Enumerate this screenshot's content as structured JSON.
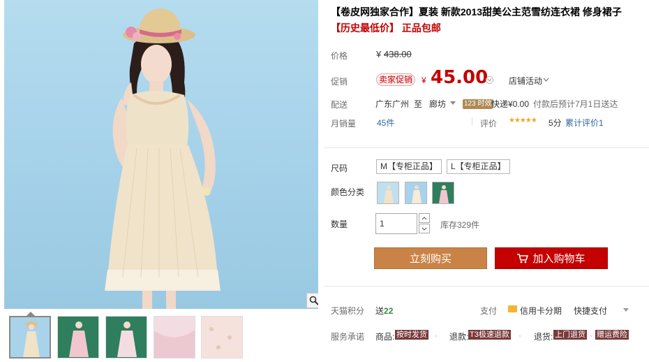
{
  "product": {
    "title": "【卷皮网独家合作】夏装 新款2013甜美公主范雪纺连衣裙 修身裙子",
    "subtitle": "【历史最低价】 正品包邮"
  },
  "price": {
    "label": "价格",
    "currency": "¥",
    "original": "438.00",
    "promo_label": "促销",
    "promo_tag": "卖家促销",
    "current": "45.00",
    "store_activity": "店铺活动"
  },
  "shipping": {
    "label": "配送",
    "from": "广东广州",
    "to_word": "至",
    "to": "廊坊",
    "badge": "123 时效",
    "express": "快递¥0.00",
    "note": "付款后预计7月1日送达"
  },
  "sales": {
    "label": "月销量",
    "count": "45件",
    "rating_label": "评价",
    "stars": "★★★★★",
    "score": "5分",
    "reviews": "累计评价1"
  },
  "size": {
    "label": "尺码",
    "options": [
      "M【专柜正品】",
      "L【专柜正品】"
    ]
  },
  "color": {
    "label": "颜色分类"
  },
  "quantity": {
    "label": "数量",
    "value": "1",
    "stock": "库存329件"
  },
  "actions": {
    "buy": "立刻购买",
    "cart": "加入购物车"
  },
  "points": {
    "label": "天猫积分",
    "value": "送22",
    "pay_label": "支付",
    "credit": "信用卡分期",
    "quick": "快捷支付"
  },
  "service": {
    "label": "服务承诺",
    "item1_prefix": "商品:",
    "item1_tag": "按时发货",
    "item2_prefix": "退款:",
    "item2_tag": "T3极速退款",
    "item3_prefix": "退货:",
    "item3_tag": "上门退货",
    "item4_tag": "赠运费险"
  },
  "colors": {
    "accent_red": "#c40000",
    "buy_button": "#c98346",
    "promo_bg": "#fff1f1"
  }
}
